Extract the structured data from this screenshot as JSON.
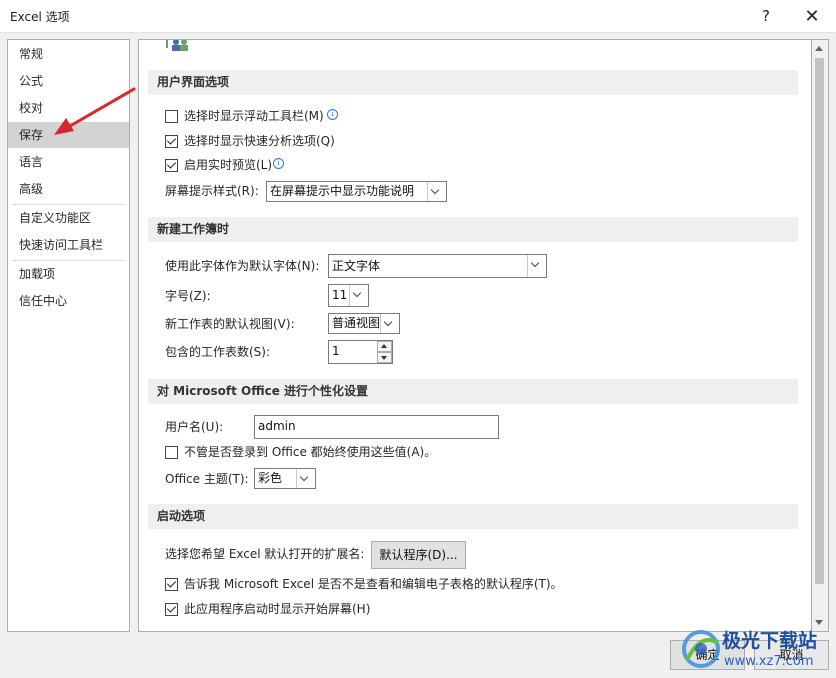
{
  "window": {
    "title": "Excel 选项",
    "help_label": "?",
    "close_label": "✕"
  },
  "sidebar": {
    "items": [
      {
        "label": "常规",
        "selected": false
      },
      {
        "label": "公式",
        "selected": false
      },
      {
        "label": "校对",
        "selected": false
      },
      {
        "label": "保存",
        "selected": true
      },
      {
        "label": "语言",
        "selected": false
      },
      {
        "label": "高级",
        "selected": false
      },
      {
        "label": "自定义功能区",
        "selected": false
      },
      {
        "label": "快速访问工具栏",
        "selected": false
      },
      {
        "label": "加载项",
        "selected": false
      },
      {
        "label": "信任中心",
        "selected": false
      }
    ]
  },
  "ui_options": {
    "header": "用户界面选项",
    "show_mini_toolbar": {
      "label": "选择时显示浮动工具栏(M)",
      "checked": false
    },
    "show_quick_analysis": {
      "label": "选择时显示快速分析选项(Q)",
      "checked": true
    },
    "enable_live_preview": {
      "label": "启用实时预览(L)",
      "checked": true
    },
    "screentip_style": {
      "label": "屏幕提示样式(R):",
      "value": "在屏幕提示中显示功能说明"
    }
  },
  "new_workbook": {
    "header": "新建工作簿时",
    "default_font": {
      "label": "使用此字体作为默认字体(N):",
      "value": "正文字体"
    },
    "font_size": {
      "label": "字号(Z):",
      "value": "11"
    },
    "default_view": {
      "label": "新工作表的默认视图(V):",
      "value": "普通视图"
    },
    "sheet_count": {
      "label": "包含的工作表数(S):",
      "value": "1"
    }
  },
  "personalize": {
    "header": "对 Microsoft Office 进行个性化设置",
    "username": {
      "label": "用户名(U):",
      "value": "admin"
    },
    "always_use": {
      "label": "不管是否登录到 Office 都始终使用这些值(A)。",
      "checked": false
    },
    "theme": {
      "label": "Office 主题(T):",
      "value": "彩色"
    }
  },
  "startup": {
    "header": "启动选项",
    "extensions_label": "选择您希望 Excel 默认打开的扩展名:",
    "default_programs_button": "默认程序(D)...",
    "tell_me_default": {
      "label": "告诉我 Microsoft Excel 是否不是查看和编辑电子表格的默认程序(T)。",
      "checked": true
    },
    "show_start_screen": {
      "label": "此应用程序启动时显示开始屏幕(H)",
      "checked": true
    }
  },
  "footer": {
    "ok_label": "确定",
    "cancel_label": "取消"
  },
  "watermark": {
    "line1": "极光下载站",
    "line2": "www.xz7.com"
  },
  "colors": {
    "accent_info": "#2b79d6",
    "annotation_arrow": "#d9262c",
    "selected_nav": "#d3d3d3"
  }
}
